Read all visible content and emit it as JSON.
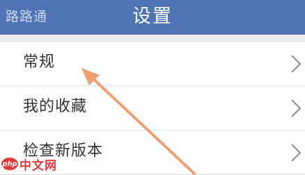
{
  "header": {
    "back_label": "路路通",
    "title": "设置",
    "background_color": "#4f73b3"
  },
  "settings": {
    "items": [
      {
        "label": "常规",
        "icon": "chevron-right-icon"
      },
      {
        "label": "我的收藏",
        "icon": "chevron-right-icon"
      },
      {
        "label": "检查新版本",
        "icon": "chevron-right-icon"
      }
    ]
  },
  "annotation": {
    "arrow_color": "#f0a070",
    "points_to": "常规"
  },
  "watermark": {
    "logo_text": "php",
    "text": "中文网"
  }
}
